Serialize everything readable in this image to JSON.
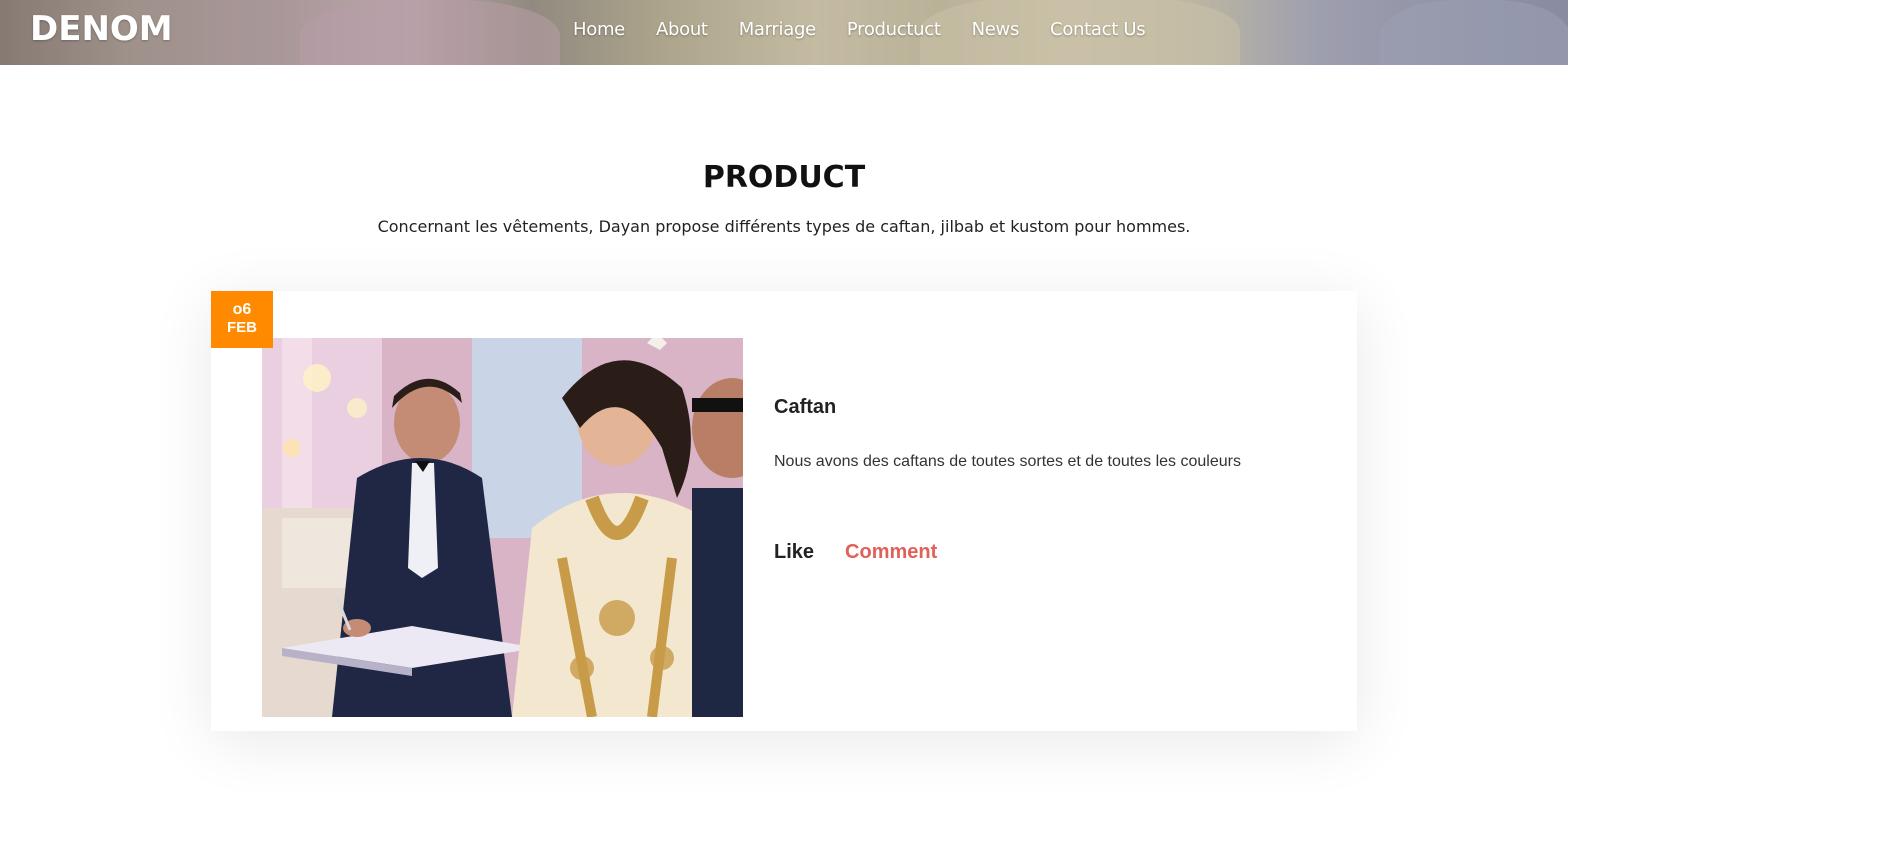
{
  "header": {
    "logo": "DENOM",
    "nav": [
      "Home",
      "About",
      "Marriage",
      "Productuct",
      "News",
      "Contact Us"
    ]
  },
  "section": {
    "title": "PRODUCT",
    "subtitle": "Concernant les vêtements, Dayan propose différents types de caftan, jilbab et kustom pour hommes."
  },
  "post": {
    "date_day": "o6",
    "date_month": "FEB",
    "title": "Caftan",
    "text": "Nous avons des caftans de toutes sortes et de toutes les couleurs",
    "like_label": "Like",
    "comment_label": "Comment"
  },
  "colors": {
    "badge": "#ff8a00",
    "comment": "#e0605a"
  }
}
